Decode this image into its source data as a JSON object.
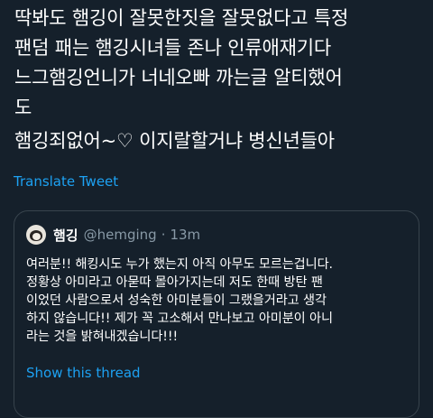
{
  "tweet": {
    "text_lines_1": "딱봐도 햄깅이 잘못한짓을 잘못없다고 특정\n팬덤 패는 햄깅시녀들 존나 인류애재기다\n느그햄깅언니가 너네오빠 까는글 알티했어\n도",
    "text_lines_2": "햄깅죄없어~♡ 이지랄할거냐 병신년들아",
    "translate_label": "Translate Tweet"
  },
  "quoted_tweet": {
    "display_name": "햄깅",
    "handle": "@hemging",
    "separator": "·",
    "time": "13m",
    "text": "여러분!! 해킹시도 누가 했는지 아직 아무도 모르는겁니다.\n정황상 아미라고 아묻따 몰아가지는데 저도 한때 방탄 팬\n이었던 사람으로서 성숙한 아미분들이 그랬을거라고 생각\n하지 않습니다!! 제가 꼭 고소해서 만나보고 아미분이 아니\n라는 것을 밝혀내겠습니다!!!",
    "show_thread_label": "Show this thread",
    "avatar_icon": "avatar-image"
  },
  "colors": {
    "background": "#15202b",
    "text": "#ffffff",
    "secondary_text": "#8899a6",
    "link": "#1da1f2",
    "border": "#38444d"
  }
}
